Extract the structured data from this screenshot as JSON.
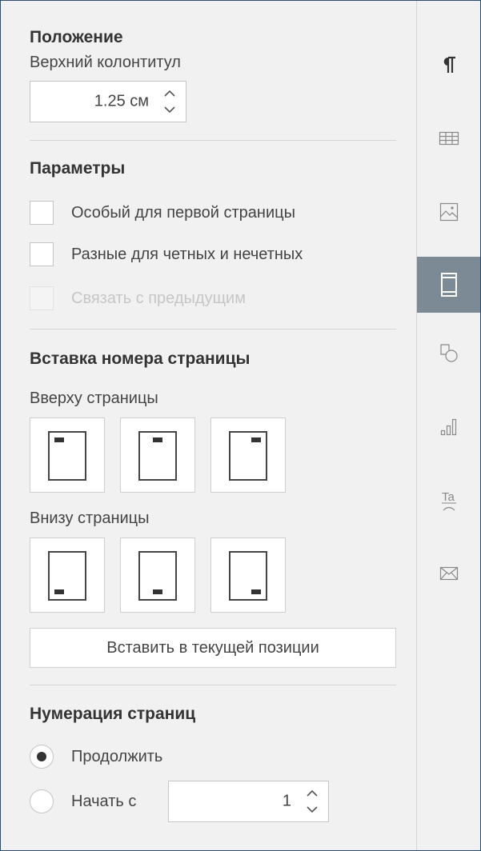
{
  "position": {
    "title": "Положение",
    "header_label": "Верхний колонтитул",
    "header_value": "1.25 см"
  },
  "params": {
    "title": "Параметры",
    "options": [
      {
        "label": "Особый для первой страницы",
        "checked": false,
        "disabled": false
      },
      {
        "label": "Разные для четных и нечетных",
        "checked": false,
        "disabled": false
      },
      {
        "label": "Связать с предыдущим",
        "checked": false,
        "disabled": true
      }
    ]
  },
  "page_number": {
    "title": "Вставка номера страницы",
    "top_label": "Вверху страницы",
    "bottom_label": "Внизу страницы",
    "top_buttons": [
      "top-left",
      "top-center",
      "top-right"
    ],
    "bottom_buttons": [
      "bottom-left",
      "bottom-center",
      "bottom-right"
    ],
    "insert_label": "Вставить в текущей позиции"
  },
  "numbering": {
    "title": "Нумерация страниц",
    "continue_label": "Продолжить",
    "start_label": "Начать с",
    "start_value": "1",
    "selected": "continue"
  },
  "right_rail": {
    "icons": [
      "paragraph-icon",
      "table-icon",
      "image-icon",
      "header-footer-icon",
      "shape-icon",
      "chart-icon",
      "text-art-icon",
      "mail-merge-icon"
    ],
    "active": "header-footer-icon",
    "active_color": "#7c8a95"
  },
  "colors": {
    "background": "#f1f1f1",
    "text": "#444444",
    "border": "#c5c5c5"
  }
}
